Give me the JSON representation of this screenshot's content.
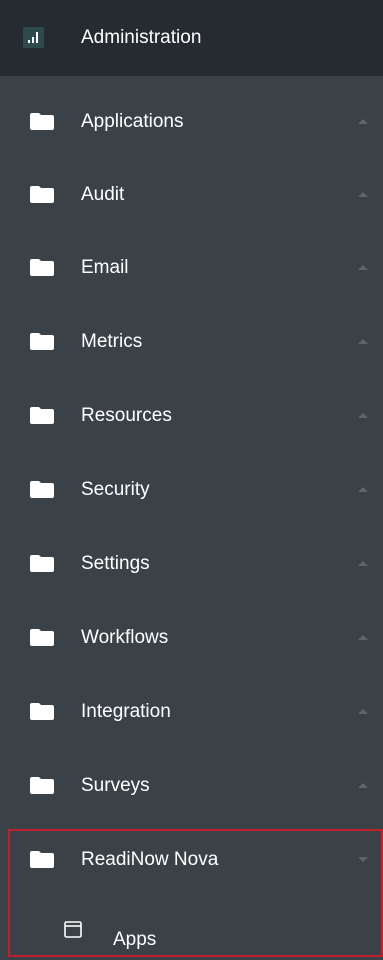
{
  "header": {
    "label": "Administration",
    "icon": "admin-chart-icon"
  },
  "items": [
    {
      "label": "Applications",
      "icon": "folder-icon",
      "state": "collapsed"
    },
    {
      "label": "Audit",
      "icon": "folder-icon",
      "state": "collapsed"
    },
    {
      "label": "Email",
      "icon": "folder-icon",
      "state": "collapsed"
    },
    {
      "label": "Metrics",
      "icon": "folder-icon",
      "state": "collapsed"
    },
    {
      "label": "Resources",
      "icon": "folder-icon",
      "state": "collapsed"
    },
    {
      "label": "Security",
      "icon": "folder-icon",
      "state": "collapsed"
    },
    {
      "label": "Settings",
      "icon": "folder-icon",
      "state": "collapsed"
    },
    {
      "label": "Workflows",
      "icon": "folder-icon",
      "state": "collapsed"
    },
    {
      "label": "Integration",
      "icon": "folder-icon",
      "state": "collapsed"
    },
    {
      "label": "Surveys",
      "icon": "folder-icon",
      "state": "collapsed"
    },
    {
      "label": "ReadiNow Nova",
      "icon": "folder-icon",
      "state": "expanded"
    }
  ],
  "sub_items": [
    {
      "label": "Apps",
      "icon": "window-icon"
    }
  ],
  "colors": {
    "background": "#3a4147",
    "header_background": "#252b30",
    "text": "#ffffff",
    "caret": "#5d656b",
    "highlight_border": "#c2202c"
  }
}
